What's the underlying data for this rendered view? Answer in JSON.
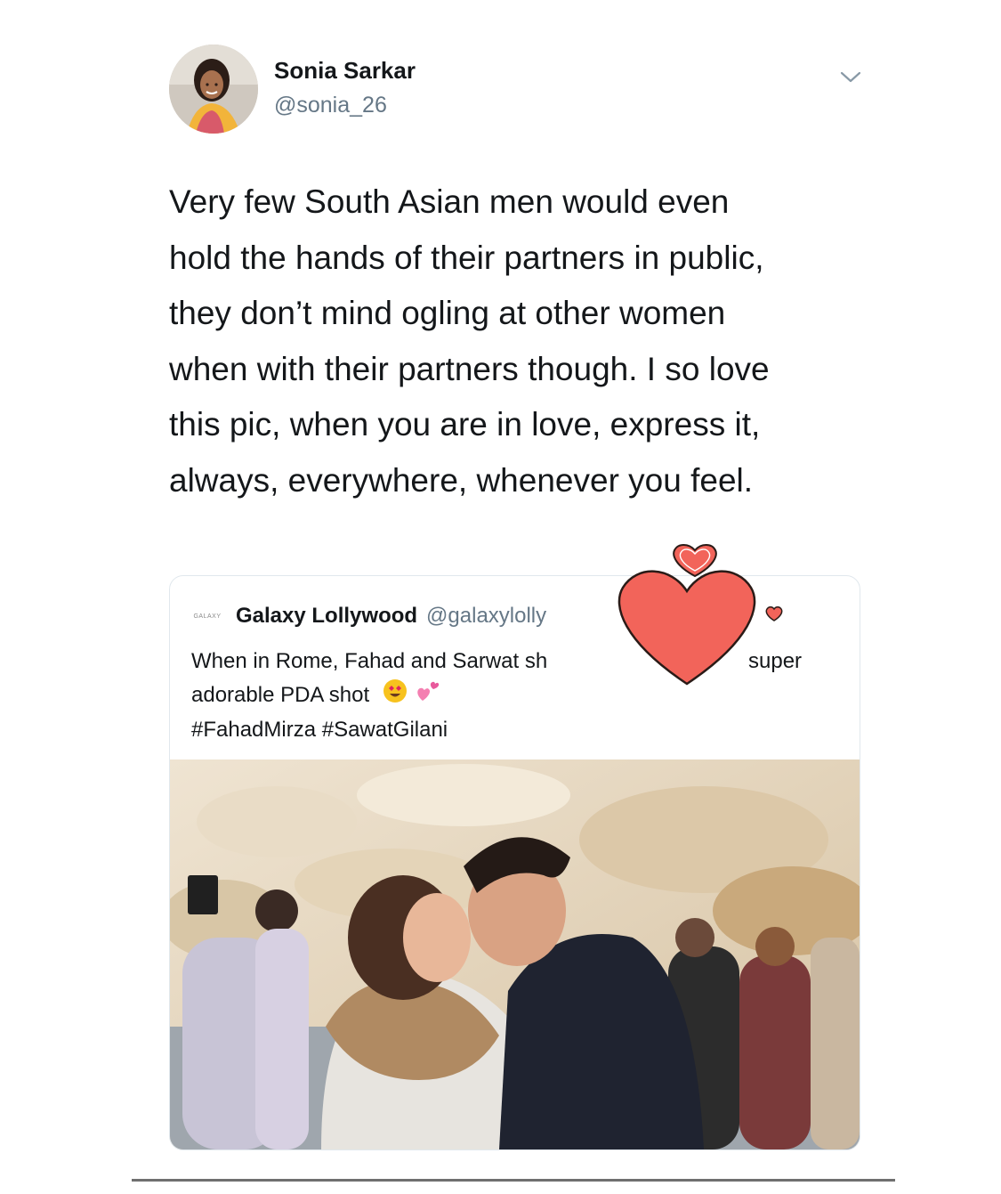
{
  "author": {
    "name": "Sonia Sarkar",
    "handle": "@sonia_26",
    "avatar_icon": "profile-photo"
  },
  "tweet": {
    "lines": [
      "Very few South Asian men would even",
      "hold the hands of their partners in public,",
      "they don’t mind ogling at other women",
      "when with their partners though. I so love",
      "this pic, when you are in love, express it,",
      "always, everywhere, whenever you feel."
    ]
  },
  "quoted": {
    "logo_text": "GALAXY",
    "name": "Galaxy Lollywood",
    "handle": "@galaxylolly",
    "line1_start": "When in Rome, Fahad and Sarwat sh",
    "line1_end": "super",
    "line2": "adorable PDA shot",
    "emojis": [
      "heart-eyes-emoji",
      "two-hearts-emoji"
    ],
    "hashtags": "#FahadMirza #SawatGilani"
  },
  "icons": {
    "menu": "chevron-down-icon",
    "stickers": [
      "heart-sticker-large",
      "heart-sticker-small-top",
      "heart-sticker-small-right"
    ]
  },
  "colors": {
    "text": "#14171a",
    "secondary": "#657786",
    "border": "#e1e8ed",
    "heart": "#f2645a"
  }
}
